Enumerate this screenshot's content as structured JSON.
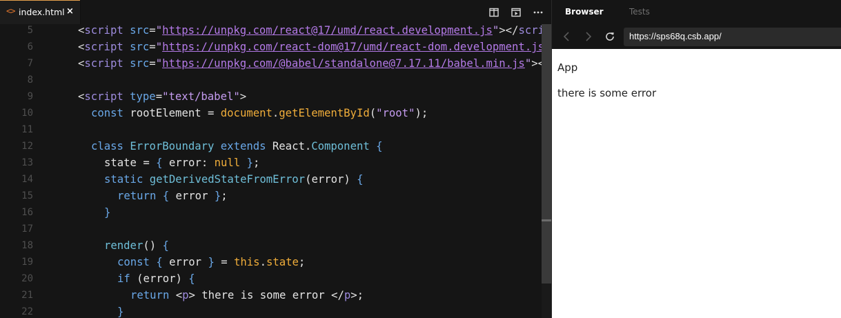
{
  "editor": {
    "tab": {
      "icon": "code-file-icon",
      "icon_glyph": "<>",
      "label": "index.html",
      "close": "×"
    },
    "actions": [
      "split-editor-icon",
      "preview-icon",
      "more-icon"
    ],
    "lines": [
      {
        "num": "5",
        "tokens": [
          {
            "t": "tagc",
            "v": "<"
          },
          {
            "t": "tg",
            "v": "script"
          },
          {
            "t": "w",
            "v": " "
          },
          {
            "t": "k",
            "v": "src"
          },
          {
            "t": "w",
            "v": "="
          },
          {
            "t": "s",
            "v": "\""
          },
          {
            "t": "u",
            "v": "https://unpkg.com/react@17/umd/react.development.js"
          },
          {
            "t": "s",
            "v": "\""
          },
          {
            "t": "tagc",
            "v": "></"
          },
          {
            "t": "tg",
            "v": "scri"
          }
        ],
        "indent": 2
      },
      {
        "num": "6",
        "tokens": [
          {
            "t": "tagc",
            "v": "<"
          },
          {
            "t": "tg",
            "v": "script"
          },
          {
            "t": "w",
            "v": " "
          },
          {
            "t": "k",
            "v": "src"
          },
          {
            "t": "w",
            "v": "="
          },
          {
            "t": "s",
            "v": "\""
          },
          {
            "t": "u",
            "v": "https://unpkg.com/react-dom@17/umd/react-dom.development.js"
          }
        ],
        "indent": 2
      },
      {
        "num": "7",
        "tokens": [
          {
            "t": "tagc",
            "v": "<"
          },
          {
            "t": "tg",
            "v": "script"
          },
          {
            "t": "w",
            "v": " "
          },
          {
            "t": "k",
            "v": "src"
          },
          {
            "t": "w",
            "v": "="
          },
          {
            "t": "s",
            "v": "\""
          },
          {
            "t": "u",
            "v": "https://unpkg.com/@babel/standalone@7.17.11/babel.min.js"
          },
          {
            "t": "s",
            "v": "\""
          },
          {
            "t": "tagc",
            "v": "><"
          }
        ],
        "indent": 2
      },
      {
        "num": "8",
        "tokens": [],
        "indent": 0
      },
      {
        "num": "9",
        "tokens": [
          {
            "t": "tagc",
            "v": "<"
          },
          {
            "t": "tg",
            "v": "script"
          },
          {
            "t": "w",
            "v": " "
          },
          {
            "t": "k",
            "v": "type"
          },
          {
            "t": "w",
            "v": "="
          },
          {
            "t": "s",
            "v": "\"text/babel\""
          },
          {
            "t": "tagc",
            "v": ">"
          }
        ],
        "indent": 2
      },
      {
        "num": "10",
        "tokens": [
          {
            "t": "k",
            "v": "const"
          },
          {
            "t": "w",
            "v": " rootElement = "
          },
          {
            "t": "fn",
            "v": "document"
          },
          {
            "t": "w",
            "v": "."
          },
          {
            "t": "fn",
            "v": "getElementById"
          },
          {
            "t": "w",
            "v": "("
          },
          {
            "t": "s",
            "v": "\"root\""
          },
          {
            "t": "w",
            "v": ");"
          }
        ],
        "indent": 3
      },
      {
        "num": "11",
        "tokens": [],
        "indent": 0
      },
      {
        "num": "12",
        "tokens": [
          {
            "t": "k",
            "v": "class"
          },
          {
            "t": "w",
            "v": " "
          },
          {
            "t": "cls",
            "v": "ErrorBoundary"
          },
          {
            "t": "w",
            "v": " "
          },
          {
            "t": "k",
            "v": "extends"
          },
          {
            "t": "w",
            "v": " React."
          },
          {
            "t": "cls",
            "v": "Component"
          },
          {
            "t": "w",
            "v": " "
          },
          {
            "t": "k",
            "v": "{"
          }
        ],
        "indent": 3
      },
      {
        "num": "13",
        "tokens": [
          {
            "t": "w",
            "v": "state = "
          },
          {
            "t": "k",
            "v": "{"
          },
          {
            "t": "w",
            "v": " error: "
          },
          {
            "t": "nul",
            "v": "null"
          },
          {
            "t": "w",
            "v": " "
          },
          {
            "t": "k",
            "v": "}"
          },
          {
            "t": "w",
            "v": ";"
          }
        ],
        "indent": 4
      },
      {
        "num": "14",
        "tokens": [
          {
            "t": "k",
            "v": "static"
          },
          {
            "t": "w",
            "v": " "
          },
          {
            "t": "cls",
            "v": "getDerivedStateFromError"
          },
          {
            "t": "w",
            "v": "(error) "
          },
          {
            "t": "k",
            "v": "{"
          }
        ],
        "indent": 4
      },
      {
        "num": "15",
        "tokens": [
          {
            "t": "k",
            "v": "return"
          },
          {
            "t": "w",
            "v": " "
          },
          {
            "t": "k",
            "v": "{"
          },
          {
            "t": "w",
            "v": " error "
          },
          {
            "t": "k",
            "v": "}"
          },
          {
            "t": "w",
            "v": ";"
          }
        ],
        "indent": 5
      },
      {
        "num": "16",
        "tokens": [
          {
            "t": "k",
            "v": "}"
          }
        ],
        "indent": 4
      },
      {
        "num": "17",
        "tokens": [],
        "indent": 0
      },
      {
        "num": "18",
        "tokens": [
          {
            "t": "cls",
            "v": "render"
          },
          {
            "t": "w",
            "v": "() "
          },
          {
            "t": "k",
            "v": "{"
          }
        ],
        "indent": 4
      },
      {
        "num": "19",
        "tokens": [
          {
            "t": "k",
            "v": "const"
          },
          {
            "t": "w",
            "v": " "
          },
          {
            "t": "k",
            "v": "{"
          },
          {
            "t": "w",
            "v": " error "
          },
          {
            "t": "k",
            "v": "}"
          },
          {
            "t": "w",
            "v": " = "
          },
          {
            "t": "fn",
            "v": "this"
          },
          {
            "t": "w",
            "v": "."
          },
          {
            "t": "fn",
            "v": "state"
          },
          {
            "t": "w",
            "v": ";"
          }
        ],
        "indent": 5
      },
      {
        "num": "20",
        "tokens": [
          {
            "t": "k",
            "v": "if"
          },
          {
            "t": "w",
            "v": " (error) "
          },
          {
            "t": "k",
            "v": "{"
          }
        ],
        "indent": 5
      },
      {
        "num": "21",
        "tokens": [
          {
            "t": "k",
            "v": "return"
          },
          {
            "t": "w",
            "v": " <"
          },
          {
            "t": "tg",
            "v": "p"
          },
          {
            "t": "w",
            "v": "> there is some error </"
          },
          {
            "t": "tg",
            "v": "p"
          },
          {
            "t": "w",
            "v": ">;"
          }
        ],
        "indent": 6
      },
      {
        "num": "22",
        "tokens": [
          {
            "t": "k",
            "v": "}"
          }
        ],
        "indent": 5
      }
    ]
  },
  "browser": {
    "tabs": [
      {
        "label": "Browser",
        "active": true
      },
      {
        "label": "Tests",
        "active": false
      }
    ],
    "url": "https://sps68q.csb.app/",
    "page": {
      "heading": "App",
      "error_text": "there is some error"
    }
  },
  "colors": {
    "tab_accent": "#e6a04d",
    "editor_bg": "#151515",
    "keyword": "#6aa8e8",
    "string": "#c59cf0",
    "function": "#f0ad3a",
    "class": "#6fbfd9"
  }
}
